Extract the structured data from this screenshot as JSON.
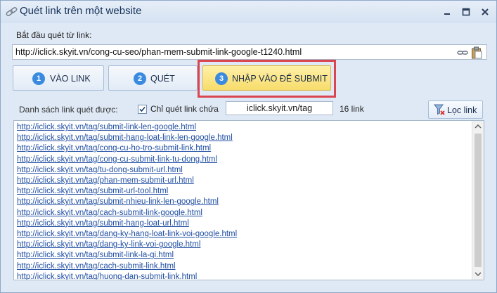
{
  "window": {
    "title": "Quét link trên một website"
  },
  "form": {
    "start_label": "Bắt đầu quét từ link:",
    "start_url": "http://iclick.skyit.vn/cong-cu-seo/phan-mem-submit-link-google-t1240.html"
  },
  "steps": [
    {
      "number": "1",
      "label": "VÀO LINK"
    },
    {
      "number": "2",
      "label": "QUÉT"
    },
    {
      "number": "3",
      "label": "NHẬP VÀO ĐỂ SUBMIT"
    }
  ],
  "filter": {
    "list_label": "Danh sách link quét được:",
    "checkbox_label": "Chỉ quét link chứa",
    "checkbox_checked": true,
    "contains_value": "iclick.skyit.vn/tag",
    "count_text": "16 link",
    "filter_button_label": "Lọc link"
  },
  "links": [
    "http://iclick.skyit.vn/tag/submit-link-len-google.html",
    "http://iclick.skyit.vn/tag/submit-hang-loat-link-len-google.html",
    "http://iclick.skyit.vn/tag/cong-cu-ho-tro-submit-link.html",
    "http://iclick.skyit.vn/tag/cong-cu-submit-link-tu-dong.html",
    "http://iclick.skyit.vn/tag/tu-dong-submit-url.html",
    "http://iclick.skyit.vn/tag/phan-mem-submit-url.html",
    "http://iclick.skyit.vn/tag/submit-url-tool.html",
    "http://iclick.skyit.vn/tag/submit-nhieu-link-len-google.html",
    "http://iclick.skyit.vn/tag/cach-submit-link-google.html",
    "http://iclick.skyit.vn/tag/submit-hang-loat-url.html",
    "http://iclick.skyit.vn/tag/dang-ky-hang-loat-link-voi-google.html",
    "http://iclick.skyit.vn/tag/dang-ky-link-voi-google.html",
    "http://iclick.skyit.vn/tag/submit-link-la-gi.html",
    "http://iclick.skyit.vn/tag/cach-submit-link.html",
    "http://iclick.skyit.vn/tag/huong-dan-submit-link.html"
  ],
  "colors": {
    "window_bg": "#dfe9f5",
    "step_number_bg": "#3a8be0",
    "active_step_bg": "#f7dc6b",
    "highlight_border": "#d9464f",
    "link_color": "#1f4ea3"
  },
  "icons": {
    "title": "link-icon",
    "minimize": "minimize-icon",
    "maximize": "maximize-icon",
    "close": "close-icon",
    "url_link": "link-chain-icon",
    "paste": "clipboard-icon",
    "filter": "filter-icon"
  }
}
